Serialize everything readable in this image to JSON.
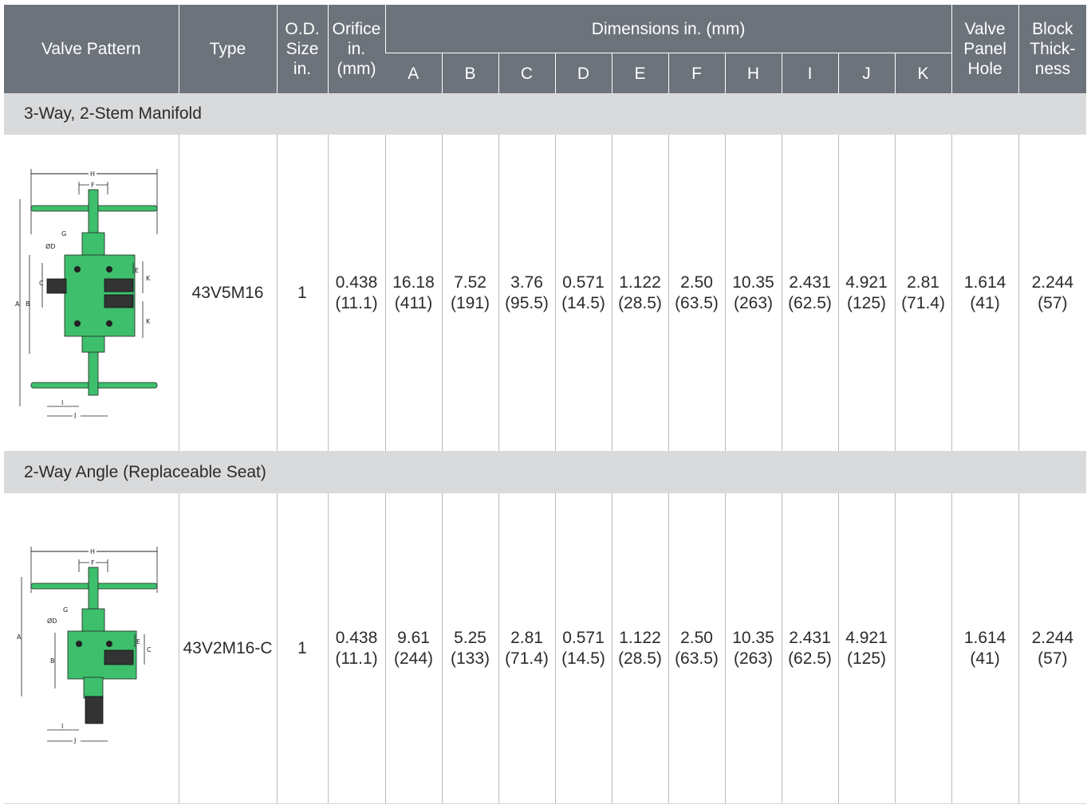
{
  "header": {
    "valve_pattern": "Valve Pattern",
    "type": "Type",
    "od_size": [
      "O.D.",
      "Size",
      "in."
    ],
    "orifice": [
      "Orifice",
      "in.",
      "(mm)"
    ],
    "dimensions": "Dimensions in. (mm)",
    "dim_cols": [
      "A",
      "B",
      "C",
      "D",
      "E",
      "F",
      "H",
      "I",
      "J",
      "K"
    ],
    "valve_panel_hole": [
      "Valve",
      "Panel",
      "Hole"
    ],
    "block_thickness": [
      "Block",
      "Thick-",
      "ness"
    ]
  },
  "sections": [
    {
      "title": "3-Way, 2-Stem Manifold",
      "row": {
        "type": "43V5M16",
        "od_size": "1",
        "orifice": [
          "0.438",
          "(11.1)"
        ],
        "dims": [
          [
            "16.18",
            "(411)"
          ],
          [
            "7.52",
            "(191)"
          ],
          [
            "3.76",
            "(95.5)"
          ],
          [
            "0.571",
            "(14.5)"
          ],
          [
            "1.122",
            "(28.5)"
          ],
          [
            "2.50",
            "(63.5)"
          ],
          [
            "10.35",
            "(263)"
          ],
          [
            "2.431",
            "(62.5)"
          ],
          [
            "4.921",
            "(125)"
          ],
          [
            "2.81",
            "(71.4)"
          ]
        ],
        "valve_panel_hole": [
          "1.614",
          "(41)"
        ],
        "block_thickness": [
          "2.244",
          "(57)"
        ]
      }
    },
    {
      "title": "2-Way Angle (Replaceable Seat)",
      "row": {
        "type": "43V2M16-C",
        "od_size": "1",
        "orifice": [
          "0.438",
          "(11.1)"
        ],
        "dims": [
          [
            "9.61",
            "(244)"
          ],
          [
            "5.25",
            "(133)"
          ],
          [
            "2.81",
            "(71.4)"
          ],
          [
            "0.571",
            "(14.5)"
          ],
          [
            "1.122",
            "(28.5)"
          ],
          [
            "2.50",
            "(63.5)"
          ],
          [
            "10.35",
            "(263)"
          ],
          [
            "2.431",
            "(62.5)"
          ],
          [
            "4.921",
            "(125)"
          ],
          [
            "",
            ""
          ]
        ],
        "valve_panel_hole": [
          "1.614",
          "(41)"
        ],
        "block_thickness": [
          "2.244",
          "(57)"
        ]
      }
    }
  ],
  "diagram_labels": {
    "manifold": [
      "H",
      "F",
      "G",
      "ØD",
      "C",
      "A",
      "B",
      "E",
      "K",
      "K",
      "I",
      "J"
    ],
    "angle": [
      "H",
      "F",
      "G",
      "ØD",
      "A",
      "B",
      "E",
      "C",
      "I",
      "J"
    ]
  },
  "colors": {
    "header_bg": "#6d737b",
    "section_bg": "#d9dadc",
    "valve_green": "#3dbf6c",
    "outline": "#222222"
  }
}
